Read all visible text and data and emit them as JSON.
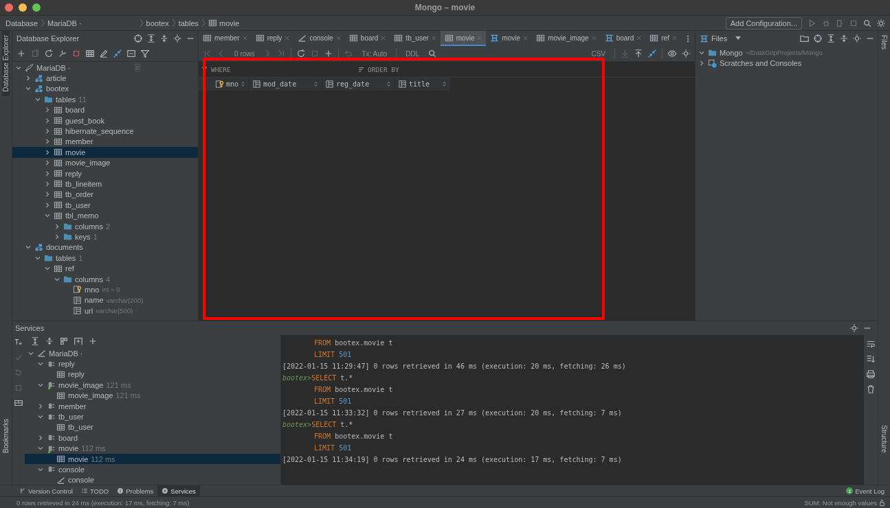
{
  "window": {
    "title": "Mongo – movie"
  },
  "breadcrumbs": [
    {
      "label": "Database",
      "kind": "plain"
    },
    {
      "label": "MariaDB ·",
      "kind": "plain"
    },
    {
      "label": "bootex",
      "kind": "plain"
    },
    {
      "label": "tables",
      "kind": "plain"
    },
    {
      "label": "movie",
      "kind": "table"
    }
  ],
  "run_configuration": {
    "label": "Add Configuration..."
  },
  "left_stripe": {
    "top": "Database Explorer",
    "bottom": "Bookmarks"
  },
  "right_stripe": {
    "top": "Files",
    "bottom": "Structure"
  },
  "database_explorer": {
    "title": "Database Explorer",
    "tree": [
      {
        "label": "MariaDB ·",
        "kind": "database",
        "badge": "2",
        "expanded": true,
        "selected": false,
        "children": [
          {
            "label": "article",
            "kind": "schema",
            "expanded": false,
            "selected": false
          },
          {
            "label": "bootex",
            "kind": "schema",
            "expanded": true,
            "selected": false,
            "children": [
              {
                "label": "tables",
                "count": "11",
                "kind": "folder",
                "expanded": true,
                "selected": false,
                "children": [
                  {
                    "label": "board",
                    "kind": "table",
                    "expanded": false,
                    "selected": false
                  },
                  {
                    "label": "guest_book",
                    "kind": "table",
                    "expanded": false,
                    "selected": false
                  },
                  {
                    "label": "hibernate_sequence",
                    "kind": "table",
                    "expanded": false,
                    "selected": false
                  },
                  {
                    "label": "member",
                    "kind": "table",
                    "expanded": false,
                    "selected": false
                  },
                  {
                    "label": "movie",
                    "kind": "table",
                    "expanded": false,
                    "selected": true
                  },
                  {
                    "label": "movie_image",
                    "kind": "table",
                    "expanded": false,
                    "selected": false
                  },
                  {
                    "label": "reply",
                    "kind": "table",
                    "expanded": false,
                    "selected": false
                  },
                  {
                    "label": "tb_lineitem",
                    "kind": "table",
                    "expanded": false,
                    "selected": false
                  },
                  {
                    "label": "tb_order",
                    "kind": "table",
                    "expanded": false,
                    "selected": false
                  },
                  {
                    "label": "tb_user",
                    "kind": "table",
                    "expanded": false,
                    "selected": false
                  },
                  {
                    "label": "tbl_memo",
                    "kind": "table",
                    "expanded": true,
                    "selected": false,
                    "children": [
                      {
                        "label": "columns",
                        "count": "2",
                        "kind": "folder",
                        "expanded": false,
                        "selected": false
                      },
                      {
                        "label": "keys",
                        "count": "1",
                        "kind": "folder",
                        "expanded": false,
                        "selected": false
                      }
                    ]
                  }
                ]
              }
            ]
          },
          {
            "label": "documents",
            "kind": "schema",
            "expanded": true,
            "selected": false,
            "children": [
              {
                "label": "tables",
                "count": "1",
                "kind": "folder",
                "expanded": true,
                "selected": false,
                "children": [
                  {
                    "label": "ref",
                    "kind": "table",
                    "expanded": true,
                    "selected": false,
                    "children": [
                      {
                        "label": "columns",
                        "count": "4",
                        "kind": "folder",
                        "expanded": true,
                        "selected": false,
                        "children": [
                          {
                            "label": "mno",
                            "detail": "int = 0",
                            "kind": "key_column",
                            "selected": false
                          },
                          {
                            "label": "name",
                            "detail": "varchar(200)",
                            "kind": "column",
                            "selected": false
                          },
                          {
                            "label": "url",
                            "detail": "varchar(500)",
                            "kind": "column",
                            "selected": false
                          }
                        ]
                      }
                    ]
                  }
                ]
              }
            ]
          }
        ]
      }
    ]
  },
  "editor_tabs": [
    {
      "label": "member",
      "kind": "table",
      "selected": false
    },
    {
      "label": "reply",
      "kind": "table",
      "selected": false
    },
    {
      "label": "console",
      "kind": "console",
      "selected": false
    },
    {
      "label": "board",
      "kind": "table",
      "selected": false
    },
    {
      "label": "tb_user",
      "kind": "table",
      "selected": false
    },
    {
      "label": "movie",
      "kind": "table",
      "selected": true
    },
    {
      "label": "movie",
      "kind": "view",
      "selected": false
    },
    {
      "label": "movie_image",
      "kind": "table",
      "selected": false
    },
    {
      "label": "board",
      "kind": "view",
      "selected": false
    },
    {
      "label": "ref",
      "kind": "table",
      "selected": false
    }
  ],
  "editor_toolbar": {
    "rows": "0 rows",
    "transaction": "Tx: Auto",
    "ddl": "DDL",
    "export": "CSV"
  },
  "filter": {
    "where": "WHERE",
    "order_by": "ORDER BY"
  },
  "grid": {
    "columns": [
      {
        "label": "mno",
        "kind": "key_column"
      },
      {
        "label": "mod_date",
        "kind": "column"
      },
      {
        "label": "reg_date",
        "kind": "column"
      },
      {
        "label": "title",
        "kind": "column"
      }
    ]
  },
  "files": {
    "title": "Files",
    "tree": [
      {
        "label": "Mongo",
        "detail": "~/DataGripProjects/Mongo",
        "kind": "folder",
        "expanded": true,
        "selected": false
      },
      {
        "label": "Scratches and Consoles",
        "kind": "scratches",
        "expanded": false,
        "selected": false
      }
    ]
  },
  "services": {
    "title": "Services",
    "tree": [
      {
        "label": "MariaDB ·",
        "kind": "datasource",
        "expanded": true,
        "selected": false,
        "children": [
          {
            "label": "reply",
            "kind": "session",
            "active": false,
            "expanded": true,
            "selected": false,
            "children": [
              {
                "label": "reply",
                "kind": "table",
                "selected": false
              }
            ]
          },
          {
            "label": "movie_image",
            "time": "121 ms",
            "kind": "session",
            "active": true,
            "expanded": true,
            "selected": false,
            "children": [
              {
                "label": "movie_image",
                "time": "121 ms",
                "kind": "table",
                "selected": false
              }
            ]
          },
          {
            "label": "member",
            "kind": "session",
            "active": false,
            "expanded": false,
            "selected": false
          },
          {
            "label": "tb_user",
            "kind": "session",
            "active": false,
            "expanded": true,
            "selected": false,
            "children": [
              {
                "label": "tb_user",
                "kind": "table",
                "selected": false
              }
            ]
          },
          {
            "label": "board",
            "kind": "session",
            "active": false,
            "expanded": false,
            "selected": false
          },
          {
            "label": "movie",
            "time": "112 ms",
            "kind": "session",
            "active": true,
            "expanded": true,
            "selected": false,
            "children": [
              {
                "label": "movie",
                "time": "112 ms",
                "kind": "table",
                "selected": true
              }
            ]
          },
          {
            "label": "console",
            "kind": "session",
            "active": false,
            "expanded": true,
            "selected": false,
            "children": [
              {
                "label": "console",
                "kind": "console",
                "selected": false
              }
            ]
          }
        ]
      }
    ],
    "console": [
      {
        "kind": "code",
        "keyword": "FROM",
        "text": "bootex.movie t"
      },
      {
        "kind": "code",
        "keyword": "LIMIT",
        "number": "501"
      },
      {
        "kind": "log",
        "text": "[2022-01-15 11:29:47] 0 rows retrieved in 46 ms (execution: 20 ms, fetching: 26 ms)"
      },
      {
        "kind": "code",
        "prompt": "bootex>",
        "keyword": "SELECT",
        "text": "t.*"
      },
      {
        "kind": "code",
        "keyword": "FROM",
        "text": "bootex.movie t"
      },
      {
        "kind": "code",
        "keyword": "LIMIT",
        "number": "501"
      },
      {
        "kind": "log",
        "text": "[2022-01-15 11:33:32] 0 rows retrieved in 27 ms (execution: 20 ms, fetching: 7 ms)"
      },
      {
        "kind": "code",
        "prompt": "bootex>",
        "keyword": "SELECT",
        "text": "t.*"
      },
      {
        "kind": "code",
        "keyword": "FROM",
        "text": "bootex.movie t"
      },
      {
        "kind": "code",
        "keyword": "LIMIT",
        "number": "501"
      },
      {
        "kind": "log",
        "text": "[2022-01-15 11:34:19] 0 rows retrieved in 24 ms (execution: 17 ms, fetching: 7 ms)"
      }
    ]
  },
  "tool_tabs": [
    {
      "label": "Version Control",
      "kind": "branch",
      "selected": false
    },
    {
      "label": "TODO",
      "kind": "list",
      "selected": false
    },
    {
      "label": "Problems",
      "kind": "info",
      "selected": false
    },
    {
      "label": "Services",
      "kind": "play",
      "selected": true
    }
  ],
  "event_log": {
    "label": "Event Log",
    "badge": "1"
  },
  "status_bar": {
    "message": "0 rows retrieved in 24 ms (execution: 17 ms, fetching: 7 ms)",
    "summary": "SUM: Not enough values"
  }
}
